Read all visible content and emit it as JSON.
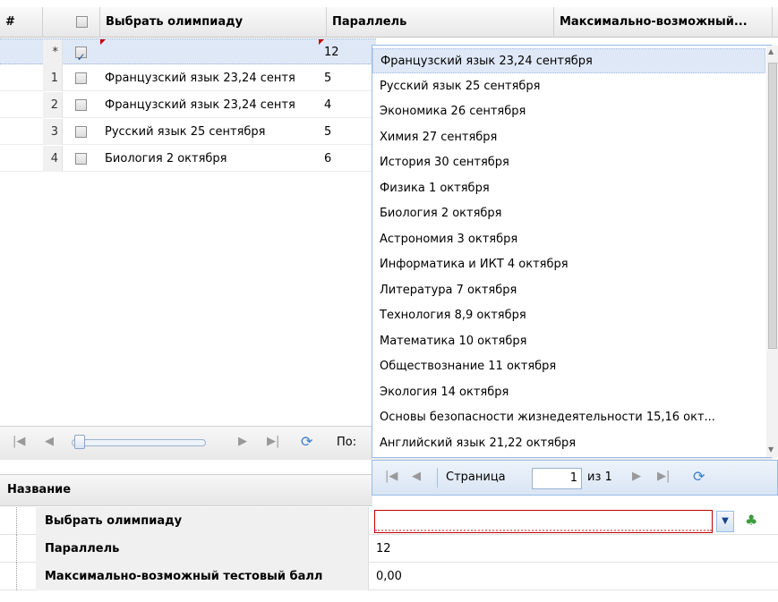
{
  "grid": {
    "headers": {
      "num": "#",
      "name": "Выбрать олимпиаду",
      "parallel": "Параллель",
      "max": "Максимально-возможный..."
    },
    "rows": [
      {
        "num": "*",
        "checked": true,
        "name": "",
        "parallel": "12"
      },
      {
        "num": "1",
        "checked": false,
        "name": "Французский язык 23,24 сентя",
        "parallel": "5"
      },
      {
        "num": "2",
        "checked": false,
        "name": "Французский язык 23,24 сентя",
        "parallel": "4"
      },
      {
        "num": "3",
        "checked": false,
        "name": "Русский язык 25 сентября",
        "parallel": "5"
      },
      {
        "num": "4",
        "checked": false,
        "name": "Биология 2 октября",
        "parallel": "6"
      }
    ],
    "pager_label": "По:"
  },
  "dropdown": {
    "items": [
      "Французский язык 23,24 сентября",
      "Русский язык 25 сентября",
      "Экономика 26 сентября",
      "Химия 27 сентября",
      "История 30 сентября",
      "Физика 1 октября",
      "Биология 2 октября",
      "Астрономия 3 октября",
      "Информатика и ИКТ 4 октября",
      "Литература 7 октября",
      "Технология 8,9 октября",
      "Математика 10 октября",
      "Обществознание 11 октября",
      "Экология 14 октября",
      "Основы безопасности жизнедеятельности 15,16 окт...",
      "Английский язык 21,22 октября"
    ],
    "pager": {
      "page_label": "Страница",
      "page_value": "1",
      "of_label": "из 1"
    }
  },
  "properties": {
    "header": "Название",
    "rows": [
      {
        "label": "Выбрать олимпиаду",
        "value": ""
      },
      {
        "label": "Параллель",
        "value": "12"
      },
      {
        "label": "Максимально-возможный тестовый балл",
        "value": "0,00"
      }
    ]
  },
  "colors": {
    "accent": "#99bbe8",
    "selected_row": "#dfe8f6",
    "invalid_border": "#c00000"
  },
  "icons": [
    "first-page-icon",
    "prev-page-icon",
    "next-page-icon",
    "last-page-icon",
    "refresh-icon",
    "dropdown-arrow-icon",
    "apply-icon"
  ]
}
